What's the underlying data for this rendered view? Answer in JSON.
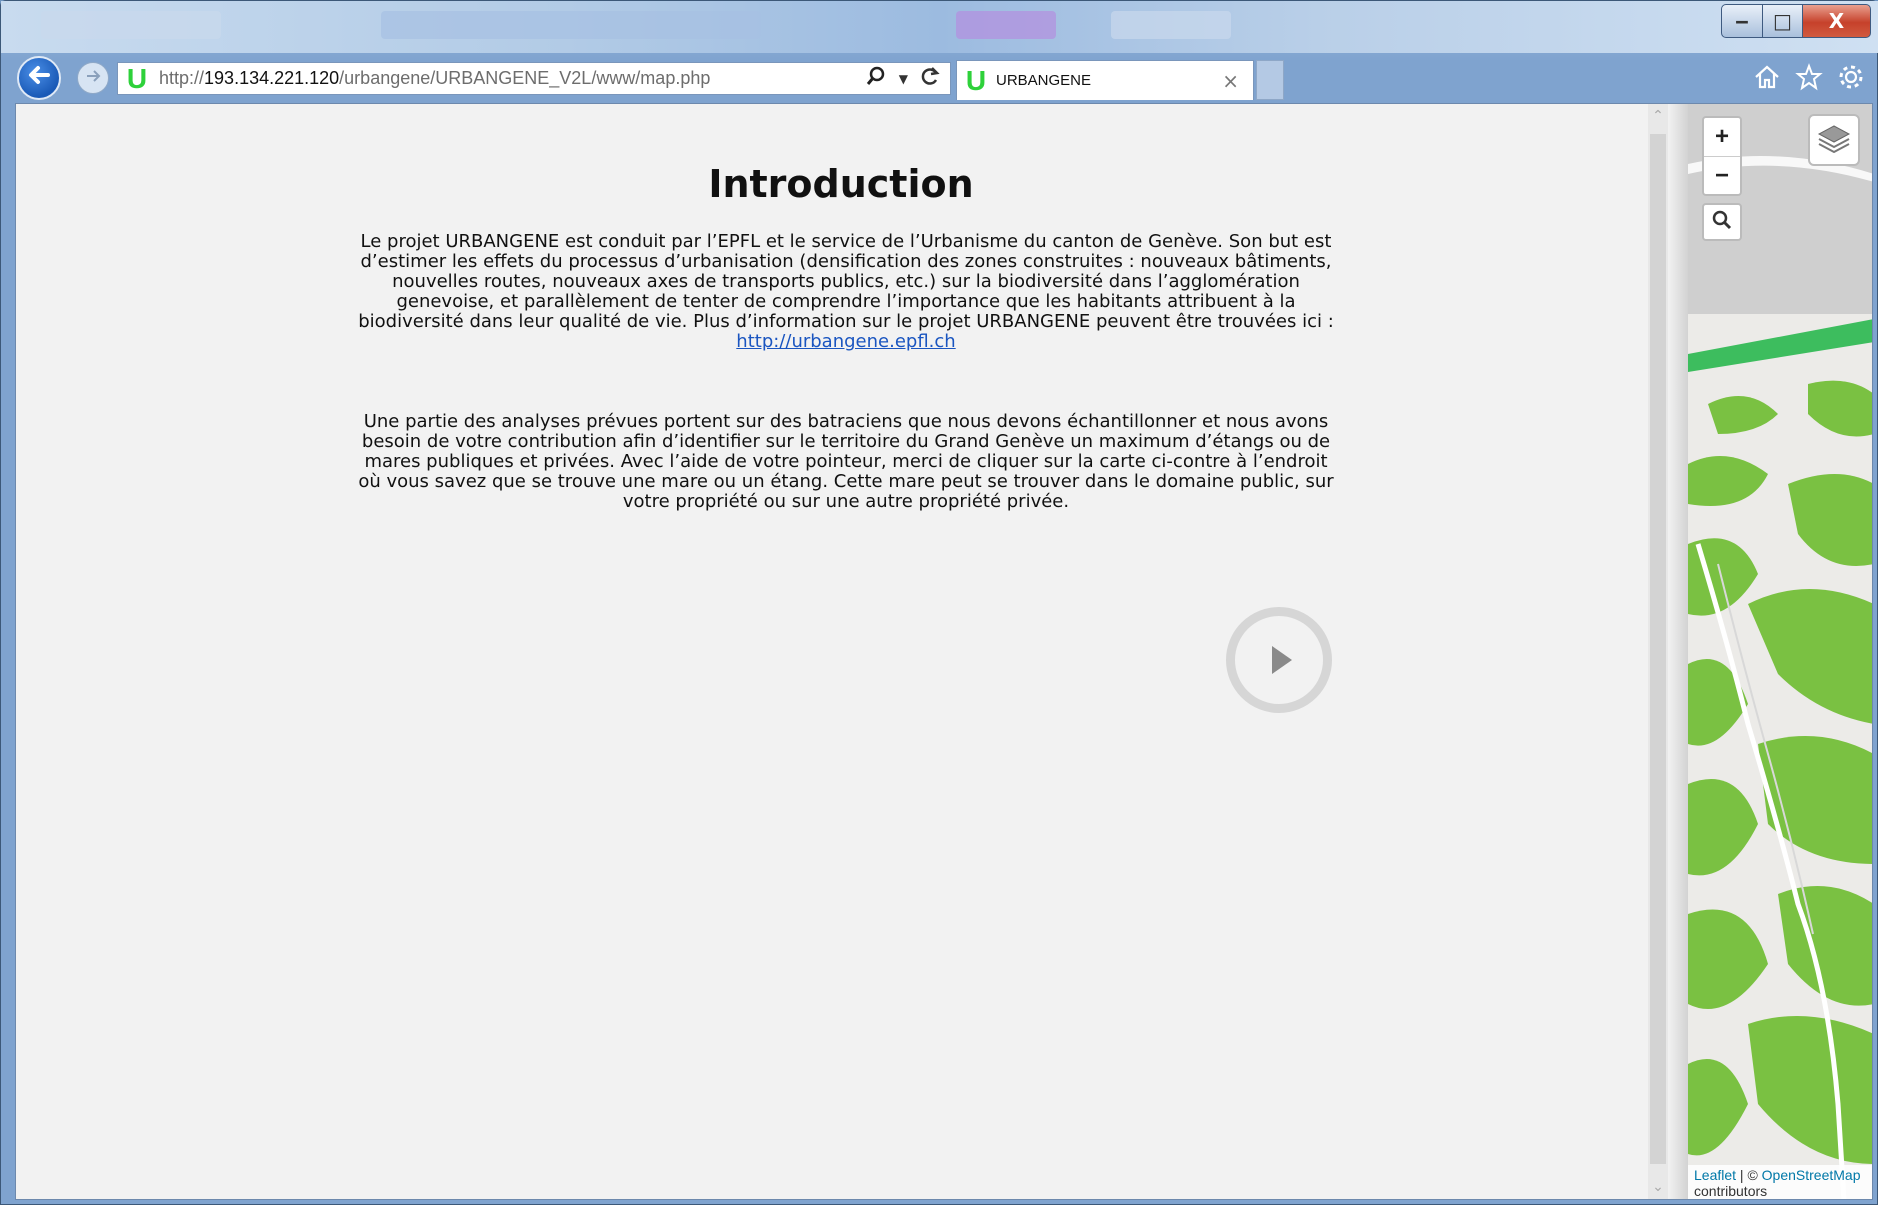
{
  "browser": {
    "url_prefix": "http://",
    "url_host": "193.134.221.120",
    "url_path": "/urbangene/URBANGENE_V2L/www/map.php",
    "tab_title": "URBANGENE",
    "tab_icon_letter": "U",
    "tab_close": "×",
    "window_controls": {
      "minimize": "‒",
      "maximize": "□",
      "close": "X"
    }
  },
  "intro": {
    "title": "Introduction",
    "paragraph1_text": "Le projet URBANGENE est conduit par l’EPFL et le service de l’Urbanisme du canton de Genève. Son but est d’estimer les effets du processus d’urbanisation (densification des zones construites : nouveaux bâtiments, nouvelles routes, nouveaux axes de transports publics, etc.) sur la biodiversité dans l’agglomération genevoise, et parallèlement de tenter de comprendre l’importance que les habitants attribuent à la biodiversité dans leur qualité de vie. Plus d’information sur le projet URBANGENE peuvent être trouvées ici : ",
    "paragraph1_link": "http://urbangene.epfl.ch",
    "paragraph2": "Une partie des analyses prévues portent sur des batraciens que nous devons échantillonner et nous avons besoin de votre contribution afin d’identifier sur le territoire du Grand Genève un maximum d’étangs ou de mares publiques et privées. Avec l’aide de votre pointeur, merci de cliquer sur la carte ci-contre à l’endroit où vous savez que se trouve une mare ou un étang. Cette mare peut se trouver dans le domaine public, sur votre propriété ou sur une autre propriété privée."
  },
  "map": {
    "zoom_in": "+",
    "zoom_out": "−",
    "attribution_leaflet": "Leaflet",
    "attribution_sep": " | © ",
    "attribution_osm": "OpenStreetMap",
    "attribution_suffix": " contributors",
    "colors": {
      "forest": "#7ac142",
      "park": "#3dbd5e",
      "base": "#ecebe8",
      "road": "#ffffff",
      "grey_area": "#cfcfcf"
    }
  },
  "icons": [
    "back-arrow-icon",
    "forward-arrow-icon",
    "search-icon",
    "refresh-icon",
    "home-icon",
    "star-icon",
    "gear-icon",
    "play-icon",
    "layers-icon"
  ]
}
